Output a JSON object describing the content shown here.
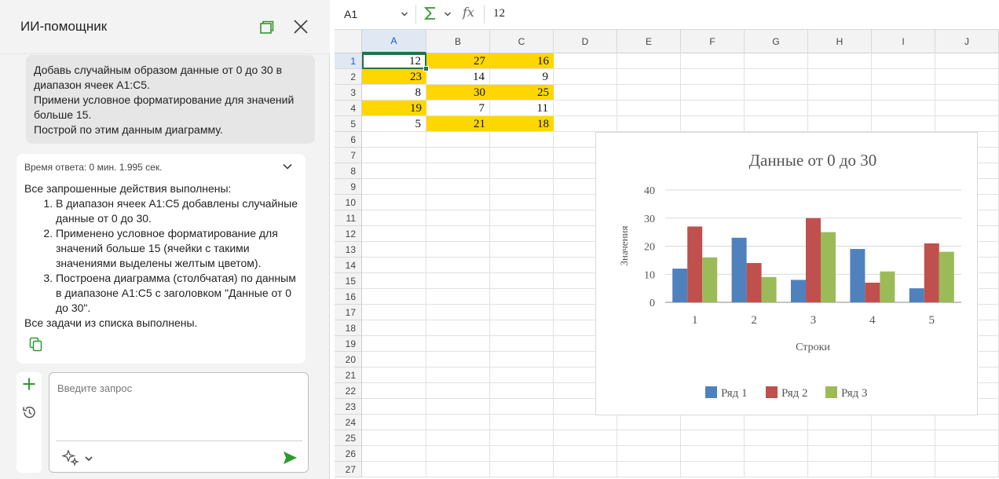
{
  "assistant": {
    "title": "ИИ-помощник",
    "user_message_lines": [
      "Добавь случайным образом данные от 0 до 30 в",
      "диапазон ячеек А1:С5.",
      "Примени условное форматирование для значений",
      "больше 15.",
      "Построй по этим данным диаграмму."
    ],
    "response_time": "Время ответа: 0 мин. 1.995 сек.",
    "response_intro": "Все запрошенные действия выполнены:",
    "response_items": [
      [
        "В диапазон ячеек A1:C5 добавлены случайные",
        "данные от 0 до 30."
      ],
      [
        "Применено условное форматирование для",
        "значений больше 15 (ячейки с такими",
        "значениями выделены желтым цветом)."
      ],
      [
        "Построена диаграмма (столбчатая) по данным",
        "в диапазоне A1:C5 с заголовком \"Данные от 0",
        "до 30\"."
      ]
    ],
    "response_outro": "Все задачи из списка выполнены.",
    "input_placeholder": "Введите запрос",
    "accent_color": "#2e9a2e"
  },
  "formula_bar": {
    "name_box": "A1",
    "formula_value": "12"
  },
  "sheet": {
    "columns": [
      "A",
      "B",
      "C",
      "D",
      "E",
      "F",
      "G",
      "H",
      "I",
      "J"
    ],
    "rows": [
      "1",
      "2",
      "3",
      "4",
      "5",
      "6",
      "7",
      "8",
      "9",
      "10",
      "11",
      "12",
      "13",
      "14",
      "15",
      "16",
      "17",
      "18",
      "19",
      "20",
      "21",
      "22",
      "23",
      "24",
      "25",
      "26",
      "27"
    ],
    "cells": [
      [
        "12",
        "27",
        "16"
      ],
      [
        "23",
        "14",
        "9"
      ],
      [
        "8",
        "30",
        "25"
      ],
      [
        "19",
        "7",
        "11"
      ],
      [
        "5",
        "21",
        "18"
      ]
    ],
    "highlight_threshold": 15,
    "highlight_color": "#ffd700",
    "selected_cell": "A1"
  },
  "chart_data": {
    "type": "bar",
    "title": "Данные от 0 до 30",
    "xlabel": "Строки",
    "ylabel": "Значения",
    "categories": [
      "1",
      "2",
      "3",
      "4",
      "5"
    ],
    "yticks": [
      "0",
      "10",
      "20",
      "30",
      "40"
    ],
    "ylim": [
      0,
      40
    ],
    "grid": true,
    "legend_position": "bottom",
    "series": [
      {
        "name": "Ряд 1",
        "values": [
          12,
          23,
          8,
          19,
          5
        ],
        "color": "#4f81bd"
      },
      {
        "name": "Ряд 2",
        "values": [
          27,
          14,
          30,
          7,
          21
        ],
        "color": "#c0504d"
      },
      {
        "name": "Ряд 3",
        "values": [
          16,
          9,
          25,
          11,
          18
        ],
        "color": "#9bbb59"
      }
    ]
  }
}
